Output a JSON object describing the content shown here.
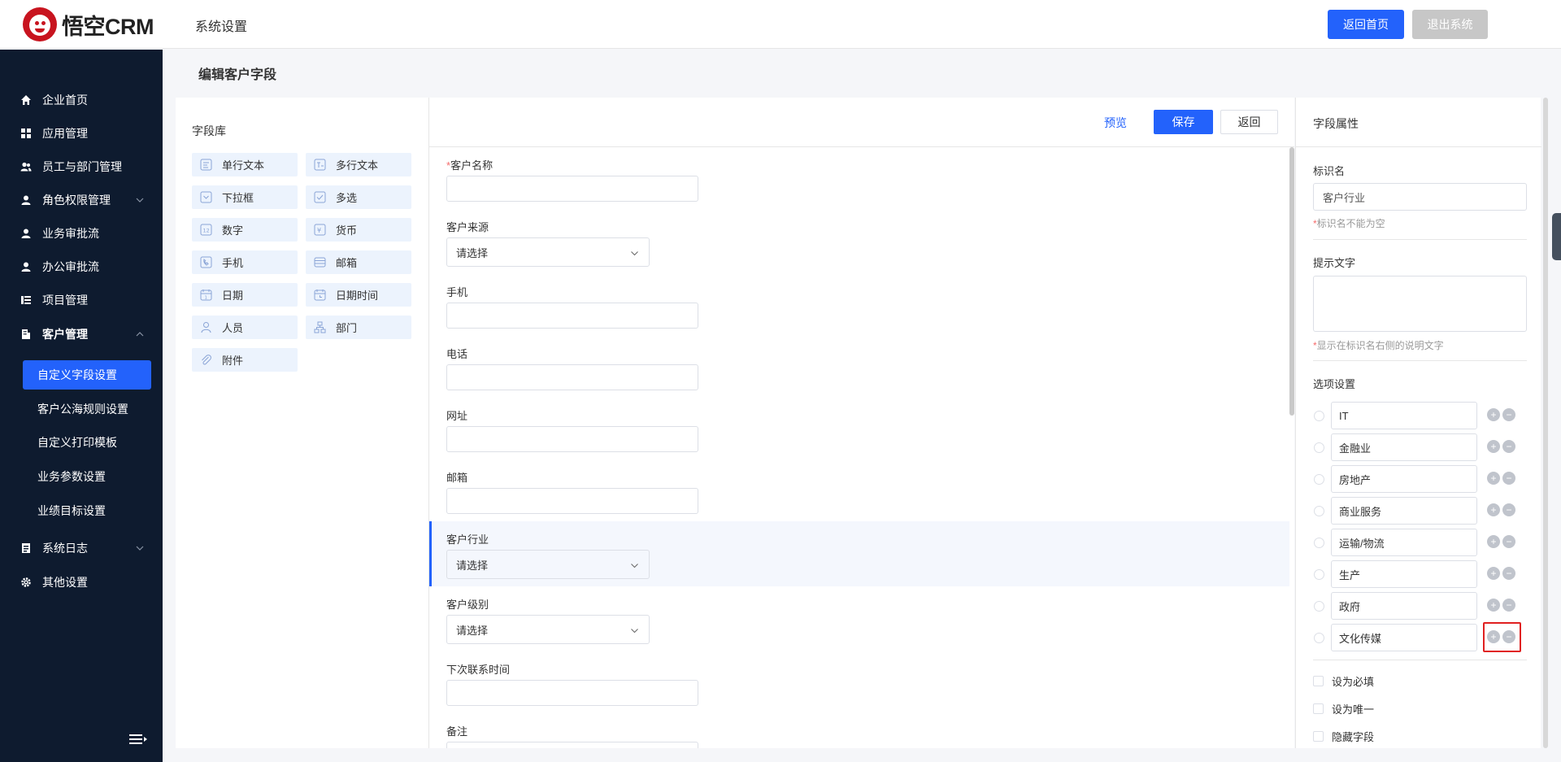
{
  "header": {
    "logo_text": "悟空CRM",
    "title": "系统设置",
    "btn_home": "返回首页",
    "btn_exit": "退出系统",
    "accent_color": "#2362fb"
  },
  "sidebar": {
    "items": [
      {
        "label": "企业首页",
        "icon": "home-icon"
      },
      {
        "label": "应用管理",
        "icon": "grid-icon"
      },
      {
        "label": "员工与部门管理",
        "icon": "users-icon"
      },
      {
        "label": "角色权限管理",
        "icon": "user-icon"
      },
      {
        "label": "业务审批流",
        "icon": "user-icon"
      },
      {
        "label": "办公审批流",
        "icon": "user-icon"
      },
      {
        "label": "项目管理",
        "icon": "list-icon"
      },
      {
        "label": "客户管理",
        "icon": "building-icon"
      },
      {
        "label": "系统日志",
        "icon": "log-icon"
      },
      {
        "label": "其他设置",
        "icon": "gear-icon"
      }
    ],
    "sub_items": [
      "自定义字段设置",
      "客户公海规则设置",
      "自定义打印模板",
      "业务参数设置",
      "业绩目标设置"
    ]
  },
  "page": {
    "title": "编辑客户字段"
  },
  "library": {
    "title": "字段库",
    "items": [
      "单行文本",
      "多行文本",
      "下拉框",
      "多选",
      "数字",
      "货币",
      "手机",
      "邮箱",
      "日期",
      "日期时间",
      "人员",
      "部门",
      "附件"
    ]
  },
  "form": {
    "preview": "预览",
    "save": "保存",
    "back": "返回",
    "fields": [
      {
        "label": "客户名称",
        "required": "*",
        "type": "input"
      },
      {
        "label": "客户来源",
        "type": "select",
        "value": "请选择"
      },
      {
        "label": "手机",
        "type": "input"
      },
      {
        "label": "电话",
        "type": "input"
      },
      {
        "label": "网址",
        "type": "input"
      },
      {
        "label": "邮箱",
        "type": "input"
      },
      {
        "label": "客户行业",
        "type": "select",
        "value": "请选择"
      },
      {
        "label": "客户级别",
        "type": "select",
        "value": "请选择"
      },
      {
        "label": "下次联系时间",
        "type": "input"
      },
      {
        "label": "备注",
        "type": "input"
      }
    ]
  },
  "props": {
    "title": "字段属性",
    "name_label": "标识名",
    "name_value": "客户行业",
    "name_hint_mark": "*",
    "name_hint": "标识名不能为空",
    "tip_label": "提示文字",
    "tip_hint_mark": "*",
    "tip_hint": "显示在标识名右侧的说明文字",
    "options_label": "选项设置",
    "options": [
      "IT",
      "金融业",
      "房地产",
      "商业服务",
      "运输/物流",
      "生产",
      "政府",
      "文化传媒"
    ],
    "checkboxes": [
      "设为必填",
      "设为唯一",
      "隐藏字段"
    ]
  }
}
